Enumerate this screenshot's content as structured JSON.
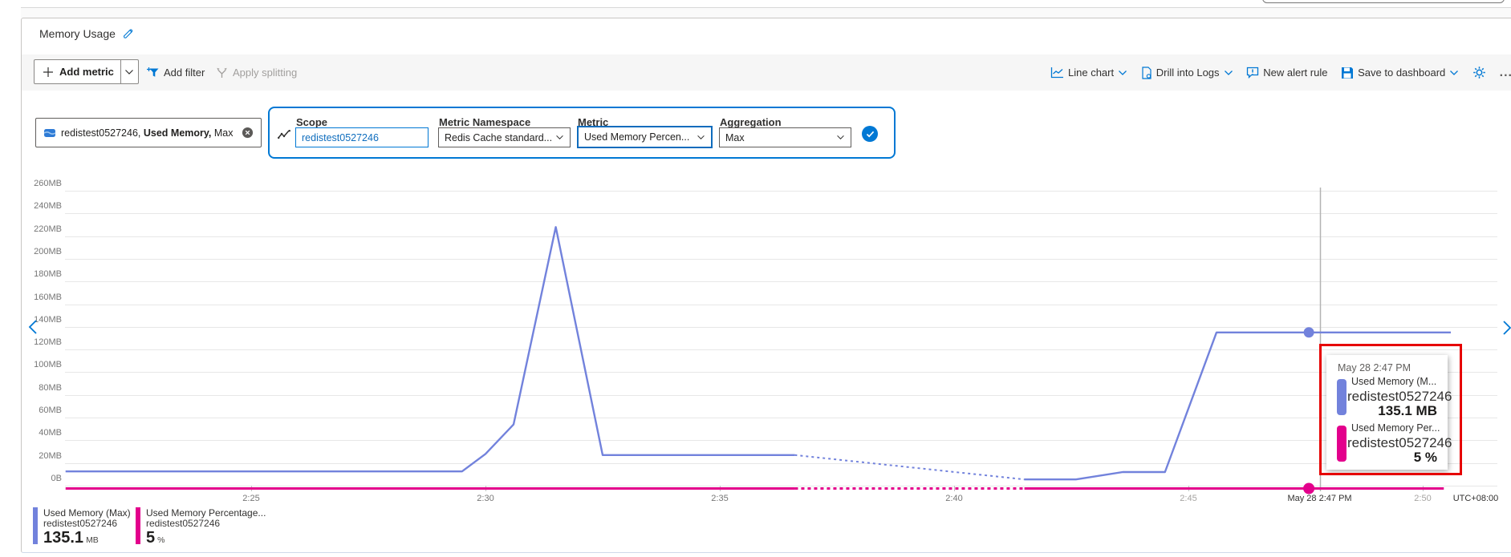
{
  "header": {
    "title": "Memory Usage"
  },
  "toolbar": {
    "add_metric": "Add metric",
    "add_filter": "Add filter",
    "apply_splitting": "Apply splitting",
    "line_chart": "Line chart",
    "drill_into_logs": "Drill into Logs",
    "new_alert_rule": "New alert rule",
    "save_to_dashboard": "Save to dashboard",
    "more": "..."
  },
  "metric_pill": {
    "resource": "redistest0527246,",
    "metric": "Used Memory,",
    "aggregation": "Max"
  },
  "scope_editor": {
    "scope_label": "Scope",
    "scope_value": "redistest0527246",
    "namespace_label": "Metric Namespace",
    "namespace_value": "Redis Cache standard...",
    "metric_label": "Metric",
    "metric_value": "Used Memory Percen...",
    "aggregation_label": "Aggregation",
    "aggregation_value": "Max"
  },
  "chart_data": {
    "type": "line",
    "title": "Memory Usage",
    "y_ticks": [
      {
        "label": "0B",
        "mb": 0
      },
      {
        "label": "20MB",
        "mb": 20
      },
      {
        "label": "40MB",
        "mb": 40
      },
      {
        "label": "60MB",
        "mb": 60
      },
      {
        "label": "80MB",
        "mb": 80
      },
      {
        "label": "100MB",
        "mb": 100
      },
      {
        "label": "120MB",
        "mb": 120
      },
      {
        "label": "140MB",
        "mb": 140
      },
      {
        "label": "160MB",
        "mb": 160
      },
      {
        "label": "180MB",
        "mb": 180
      },
      {
        "label": "200MB",
        "mb": 200
      },
      {
        "label": "220MB",
        "mb": 220
      },
      {
        "label": "240MB",
        "mb": 240
      },
      {
        "label": "260MB",
        "mb": 260
      }
    ],
    "x_ticks": [
      {
        "label": "2:25",
        "t": 0
      },
      {
        "label": "2:30",
        "t": 5
      },
      {
        "label": "2:35",
        "t": 10
      },
      {
        "label": "2:40",
        "t": 15
      },
      {
        "label": "2:45",
        "t": 20,
        "muted": true
      },
      {
        "label": "2:50",
        "t": 25,
        "muted": true
      }
    ],
    "timezone_label": "UTC+08:00",
    "cursor_time_label": "May 28 2:47 PM",
    "cursor_t_min": 22.8,
    "selected_t_min": 22.57,
    "series": [
      {
        "name": "Used Memory (Max)",
        "resource": "redistest0527246",
        "unit": "MB",
        "color": "#7282dc",
        "solid_before": [
          [
            -3.96,
            12.6
          ],
          [
            4.5,
            12.6
          ],
          [
            5.0,
            28
          ],
          [
            5.6,
            54
          ],
          [
            6.5,
            228
          ],
          [
            7.5,
            27
          ],
          [
            11.6,
            27
          ]
        ],
        "dotted": [
          [
            11.6,
            27
          ],
          [
            16.5,
            5.5
          ]
        ],
        "solid_after": [
          [
            16.5,
            5.5
          ],
          [
            17.6,
            5.5
          ],
          [
            18.6,
            12
          ],
          [
            19.5,
            12
          ],
          [
            20.6,
            135.1
          ],
          [
            25.6,
            135.1
          ]
        ],
        "selected_value": 135.1
      },
      {
        "name": "Used Memory Percentage...",
        "resource": "redistest0527246",
        "unit": "%",
        "color": "#e3008c",
        "solid_before_t": [
          -3.96,
          11.6
        ],
        "dotted_t": [
          11.6,
          16.5
        ],
        "solid_after_t": [
          16.5,
          25.45
        ],
        "selected_value": 5
      }
    ],
    "tooltip": {
      "time": "May 28 2:47 PM",
      "rows": [
        {
          "name": "Used Memory (M...",
          "resource": "redistest0527246",
          "value": "135.1 MB",
          "color": "#7282dc"
        },
        {
          "name": "Used Memory Per...",
          "resource": "redistest0527246",
          "value": "5 %",
          "color": "#e3008c"
        }
      ]
    },
    "legend": [
      {
        "label": "Used Memory (Max)",
        "resource": "redistest0527246",
        "value": "135.1",
        "unit": "MB",
        "color": "#7282dc"
      },
      {
        "label": "Used Memory Percentage...",
        "resource": "redistest0527246",
        "value": "5",
        "unit": "%",
        "color": "#e3008c"
      }
    ]
  }
}
